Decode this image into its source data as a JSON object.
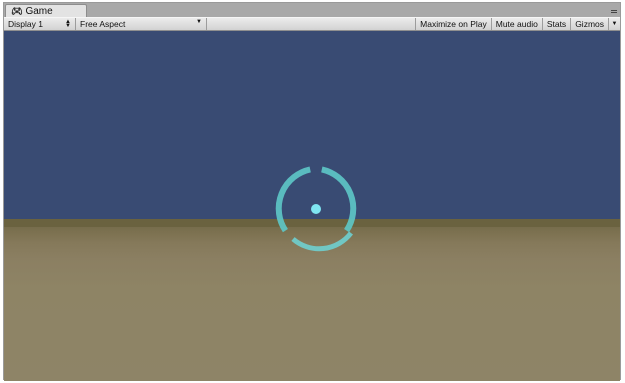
{
  "window": {
    "tab_title": "Game",
    "tab_icon": "unity-game-icon",
    "menu_icon": "window-menu-icon"
  },
  "toolbar": {
    "display": {
      "label": "Display 1",
      "icon": "updown-arrows-icon"
    },
    "aspect": {
      "label": "Free Aspect",
      "icon": "dropdown-arrow-icon"
    },
    "maximize_on_play": "Maximize on Play",
    "mute_audio": "Mute audio",
    "stats": "Stats",
    "gizmos": {
      "label": "Gizmos",
      "icon": "dropdown-arrow-icon"
    }
  },
  "scene": {
    "sky_color": "#394b73",
    "ground_color": "#8e8465",
    "reticle_color": "#5ec8c8",
    "reticle_dot_color": "#7fe6f2"
  }
}
